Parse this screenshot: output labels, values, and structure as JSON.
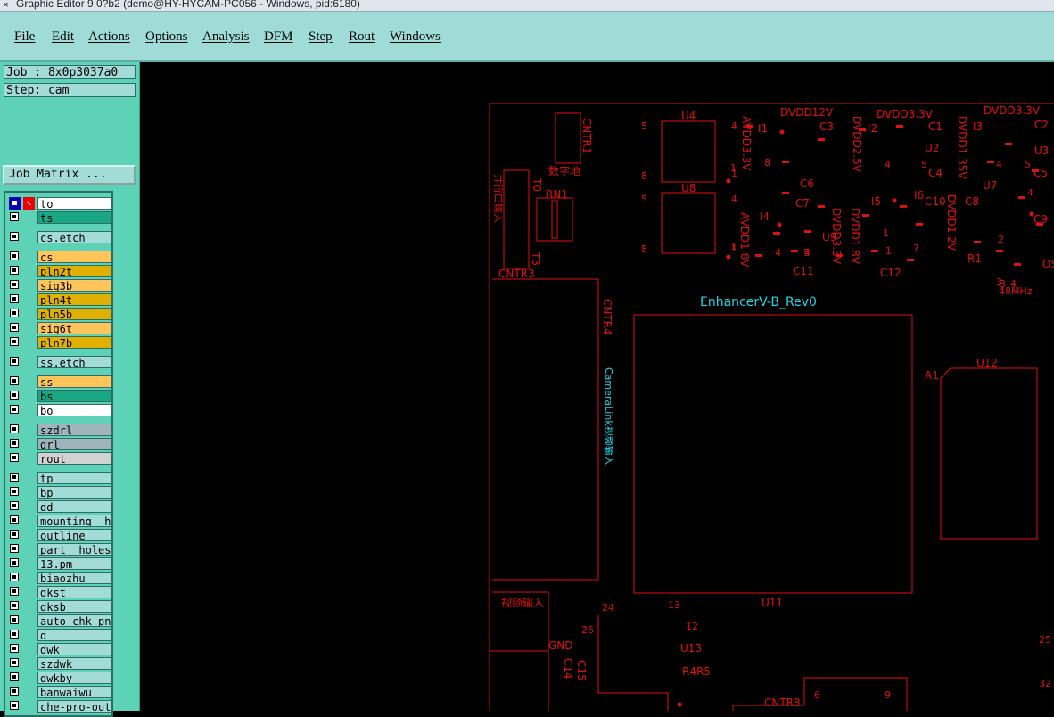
{
  "window": {
    "title": "Graphic Editor 9.0?b2 (demo@HY-HYCAM-PC056 - Windows, pid:6180)"
  },
  "menu": [
    "File",
    "Edit",
    "Actions",
    "Options",
    "Analysis",
    "DFM",
    "Step",
    "Rout",
    "Windows"
  ],
  "job": {
    "job_line": "Job : 8x0p3037a0",
    "step_line": "Step: cam",
    "matrix_button": "Job Matrix ..."
  },
  "layers": [
    {
      "name": "to",
      "color": "#ffffff",
      "selected": true
    },
    {
      "name": "ts",
      "color": "#1aa884"
    },
    {
      "name": "cs.etch",
      "color": "#a3dcd6"
    },
    {
      "name": "cs",
      "color": "#ffc45a"
    },
    {
      "name": "pln2t",
      "color": "#e0b000"
    },
    {
      "name": "sig3b",
      "color": "#ffc45a"
    },
    {
      "name": "pln4t",
      "color": "#e0b000"
    },
    {
      "name": "pln5b",
      "color": "#e0b000"
    },
    {
      "name": "sig6t",
      "color": "#ffc45a"
    },
    {
      "name": "pln7b",
      "color": "#e0b000"
    },
    {
      "name": "ss.etch",
      "color": "#a3dcd6"
    },
    {
      "name": "ss",
      "color": "#ffc45a"
    },
    {
      "name": "bs",
      "color": "#1aa884"
    },
    {
      "name": "bo",
      "color": "#ffffff"
    },
    {
      "name": "szdrl",
      "color": "#9fb5bb"
    },
    {
      "name": "drl",
      "color": "#9fb5bb"
    },
    {
      "name": "rout",
      "color": "#d2d2d2"
    },
    {
      "name": "tp",
      "color": "#a3dcd6"
    },
    {
      "name": "bp",
      "color": "#a3dcd6"
    },
    {
      "name": "dd",
      "color": "#a3dcd6"
    },
    {
      "name": "mounting__ho",
      "color": "#a3dcd6"
    },
    {
      "name": "outline",
      "color": "#a3dcd6"
    },
    {
      "name": "part__holes",
      "color": "#a3dcd6"
    },
    {
      "name": "13.pm",
      "color": "#a3dcd6"
    },
    {
      "name": "biaozhu",
      "color": "#a3dcd6"
    },
    {
      "name": "dkst",
      "color": "#a3dcd6"
    },
    {
      "name": "dksb",
      "color": "#a3dcd6"
    },
    {
      "name": "auto_chk_pnl",
      "color": "#a3dcd6"
    },
    {
      "name": "d",
      "color": "#a3dcd6"
    },
    {
      "name": "dwk",
      "color": "#a3dcd6"
    },
    {
      "name": "szdwk",
      "color": "#a3dcd6"
    },
    {
      "name": "dwkby",
      "color": "#a3dcd6"
    },
    {
      "name": "banwaiwu",
      "color": "#a3dcd6"
    },
    {
      "name": "che-pro-out",
      "color": "#a3dcd6"
    }
  ],
  "colors": {
    "pcb_red": "#e01010",
    "silk_cyan": "#20d8e8",
    "menu_bg": "#9fdcd8",
    "panel_bg": "#5dd2b6"
  },
  "board": {
    "refdes": [
      "U4",
      "U8",
      "U2",
      "U3",
      "U7",
      "U9",
      "U11",
      "U12",
      "U13",
      "RN1",
      "CNTR1",
      "CNTR3",
      "CNTR4",
      "CNTR8",
      "C1",
      "C2",
      "C3",
      "C4",
      "C5",
      "C6",
      "C7",
      "C8",
      "C9",
      "C10",
      "C11",
      "C12",
      "C14",
      "C15",
      "I1",
      "I2",
      "I3",
      "I4",
      "I5",
      "I6",
      "T0",
      "T3",
      "R1",
      "R4R5",
      "A1",
      "GND",
      "OSC"
    ],
    "nets": [
      "DVDD12V",
      "DVDD3.3V",
      "DVDD3.3V",
      "AVDD3.3V",
      "DVDD2.5V",
      "DVDD1.35V",
      "AVDD1.8V",
      "DVDD3.3V",
      "DVDD1.8V",
      "DVDD1.2V"
    ],
    "pins": [
      "5",
      "8",
      "5",
      "8",
      "4",
      "1",
      "4",
      "1",
      "4",
      "5",
      "4",
      "5",
      "1",
      "3",
      "4",
      "8",
      "4",
      "5",
      "2",
      "1",
      "4",
      "7",
      "3",
      "4",
      "25",
      "32",
      "24",
      "26",
      "13",
      "12",
      "6",
      "9",
      "1",
      "1"
    ],
    "freq": "48MHz",
    "board_name": "EnhancerV-B_Rev0",
    "cameralink": "CameraLink视频输入",
    "digital": "数字地",
    "video_in": "视频输入",
    "pp_port": "并行口输入"
  }
}
